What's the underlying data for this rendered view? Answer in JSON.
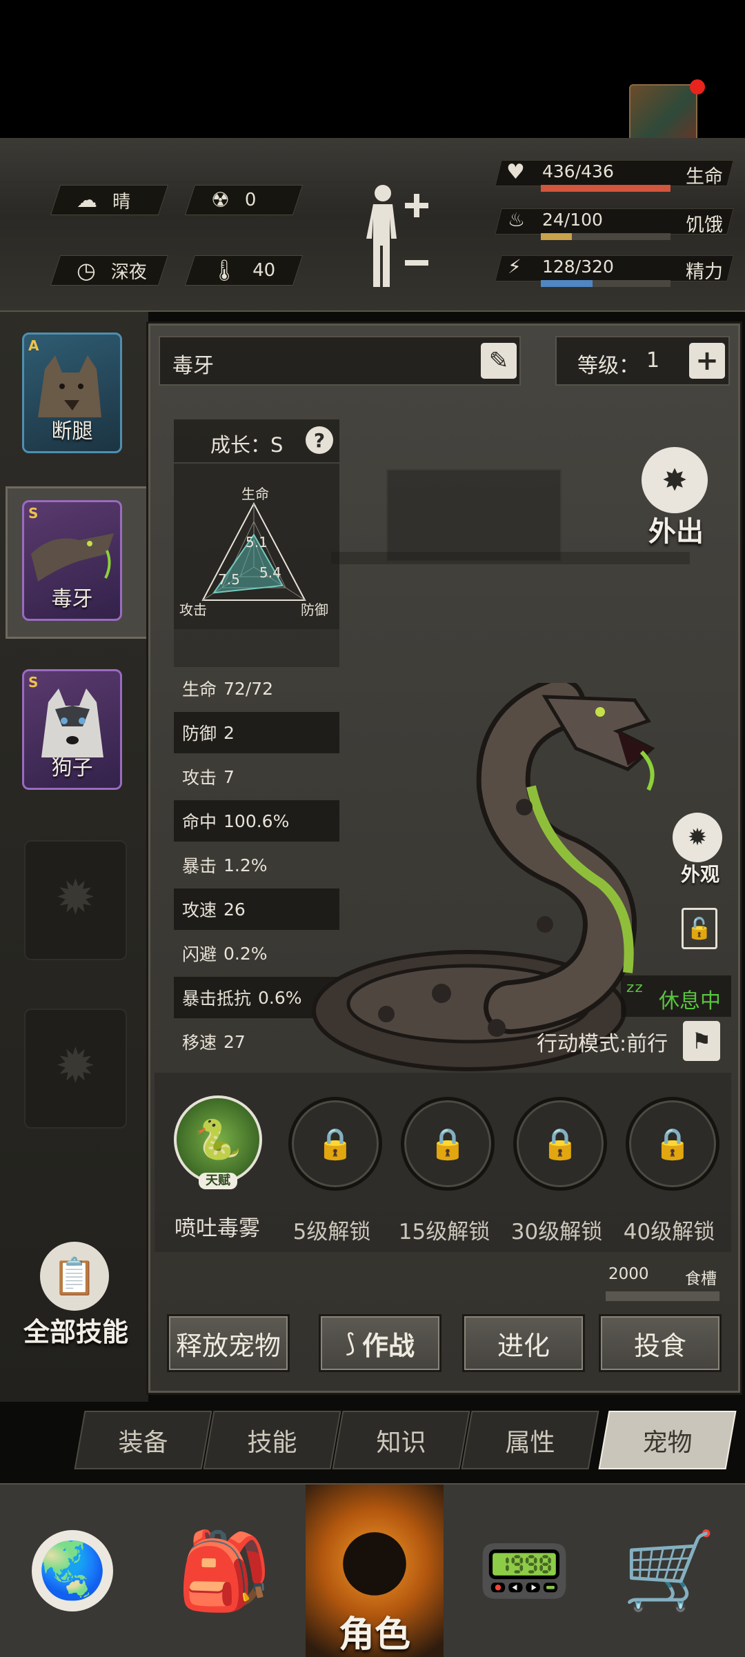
{
  "hud": {
    "weather": "晴",
    "radiation": "0",
    "time_of_day": "深夜",
    "temperature": "40",
    "health": {
      "value": "436/436",
      "label": "生命",
      "fill": 1.0,
      "color": "#d2553c"
    },
    "hunger": {
      "value": "24/100",
      "label": "饥饿",
      "fill": 0.24,
      "color": "#c9a24a"
    },
    "energy": {
      "value": "128/320",
      "label": "精力",
      "fill": 0.4,
      "color": "#4f86c4"
    }
  },
  "pets": [
    {
      "name": "断腿",
      "rank": "A",
      "state": "normal"
    },
    {
      "name": "毒牙",
      "rank": "S",
      "state": "selected"
    },
    {
      "name": "狗子",
      "rank": "S",
      "state": "normal"
    }
  ],
  "all_skills_label": "全部技能",
  "pet": {
    "name": "毒牙",
    "level_label": "等级：",
    "level": "1",
    "growth": "成长：S",
    "radar": {
      "life_label": "生命",
      "attack_label": "攻击",
      "defense_label": "防御",
      "life": "5.1",
      "attack": "7.5",
      "defense": "5.4",
      "life_value": 5.1,
      "attack_value": 7.5,
      "defense_value": 5.4
    },
    "attributes": [
      {
        "label": "生命",
        "value": "72/72"
      },
      {
        "label": "防御",
        "value": "2"
      },
      {
        "label": "攻击",
        "value": "7"
      },
      {
        "label": "命中",
        "value": "100.6%"
      },
      {
        "label": "暴击",
        "value": "1.2%"
      },
      {
        "label": "攻速",
        "value": "26"
      },
      {
        "label": "闪避",
        "value": "0.2%"
      },
      {
        "label": "暴击抵抗",
        "value": "0.6%"
      },
      {
        "label": "移速",
        "value": "27"
      }
    ],
    "go_out_label": "外出",
    "appearance_label": "外观",
    "status": "休息中",
    "action_mode": "行动模式:前行"
  },
  "skills": {
    "talent_badge": "天赋",
    "talent_name": "喷吐毒雾",
    "locked": [
      "5级解锁",
      "15级解锁",
      "30级解锁",
      "40级解锁"
    ]
  },
  "food": {
    "amount": "2000",
    "label": "食槽"
  },
  "actions": {
    "release": "释放宠物",
    "battle": "作战",
    "evolve": "进化",
    "feed": "投食"
  },
  "tabs": [
    "装备",
    "技能",
    "知识",
    "属性",
    "宠物"
  ],
  "nav": {
    "role_label": "角色"
  }
}
